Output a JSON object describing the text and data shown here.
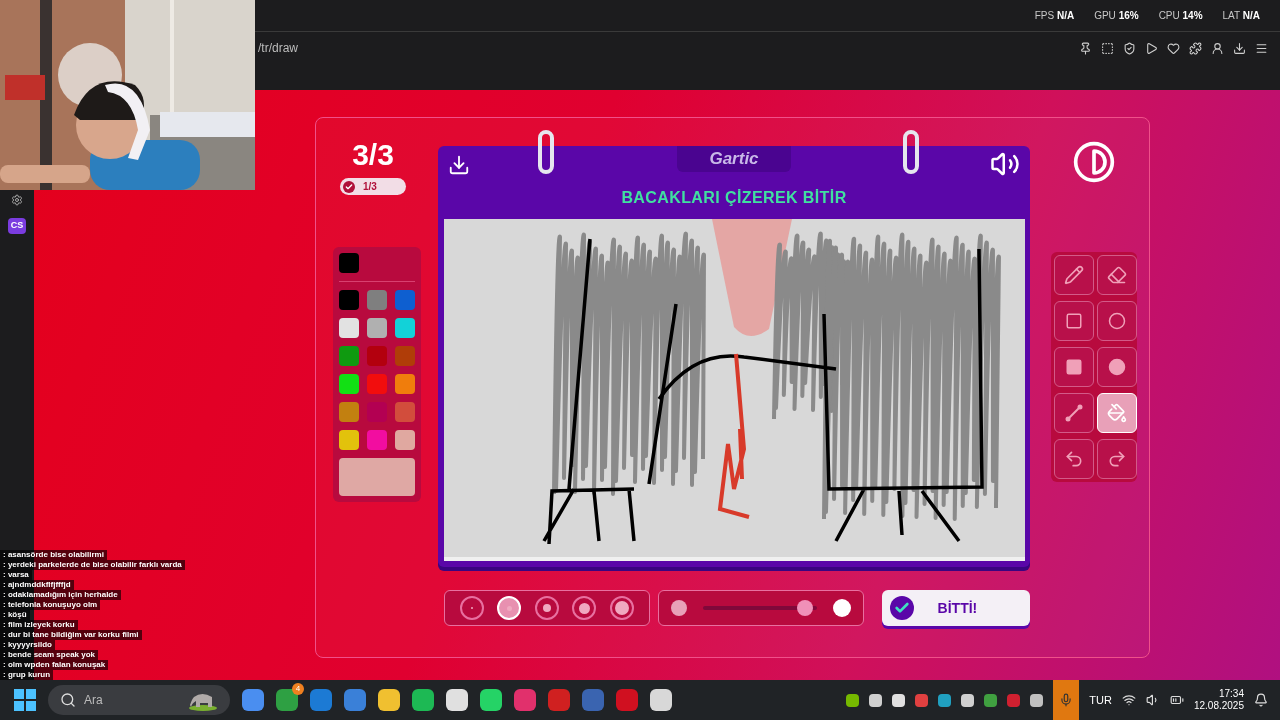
{
  "browser": {
    "url": "/tr/draw",
    "stats": [
      {
        "label": "FPS",
        "value": "N/A"
      },
      {
        "label": "GPU",
        "value": "16%"
      },
      {
        "label": "CPU",
        "value": "14%"
      },
      {
        "label": "LAT",
        "value": "N/A"
      }
    ],
    "sidebar_badge": "CS"
  },
  "chat": [
    {
      "text": ": asansörde bise olabilirmi"
    },
    {
      "text": ": yerdeki parkelerde de bise olabilir farklı varda"
    },
    {
      "text": ": varsa"
    },
    {
      "text": ": ajndmddkflfjfffjd"
    },
    {
      "text": ": odaklamadığım için herhalde"
    },
    {
      "text": ": telefonla konuşuyo olm"
    },
    {
      "text": ": köşü"
    },
    {
      "text": ": film izleyek korku"
    },
    {
      "text": ": dur bi tane bildiğim var korku filmi"
    },
    {
      "text": ": kyyyyrsildo"
    },
    {
      "text": ": bende seam speak yok"
    },
    {
      "text": ": olm wpden falan konuşak"
    },
    {
      "text": ": grup kurun"
    }
  ],
  "game": {
    "round": "3/3",
    "progress": "1/3",
    "logo": "Gartic",
    "prompt": "BACAKLARI ÇİZEREK BİTİR",
    "current_colors": [
      {
        "color": "#000000"
      },
      {
        "color": "#dfa8a4"
      }
    ],
    "palette": [
      {
        "color": "#000000"
      },
      {
        "color": "#7f7f7f"
      },
      {
        "color": "#0e5fd0"
      },
      {
        "color": "#e2e2e2"
      },
      {
        "color": "#b0b0b0"
      },
      {
        "color": "#12d2d8"
      },
      {
        "color": "#0f9a10"
      },
      {
        "color": "#b3000e"
      },
      {
        "color": "#b03d08"
      },
      {
        "color": "#12e014"
      },
      {
        "color": "#f20d0d"
      },
      {
        "color": "#f07d0c"
      },
      {
        "color": "#c28010"
      },
      {
        "color": "#b30052"
      },
      {
        "color": "#d24d3c"
      },
      {
        "color": "#e2c20c"
      },
      {
        "color": "#f20da0"
      },
      {
        "color": "#e0a8a0"
      }
    ],
    "tools": [
      {
        "kind": "pencil",
        "selected": false
      },
      {
        "kind": "eraser",
        "selected": false
      },
      {
        "kind": "rectangle",
        "selected": false
      },
      {
        "kind": "ellipse",
        "selected": false
      },
      {
        "kind": "filled-rectangle",
        "selected": false
      },
      {
        "kind": "filled-ellipse",
        "selected": false
      },
      {
        "kind": "line",
        "selected": false
      },
      {
        "kind": "fill",
        "selected": true
      },
      {
        "kind": "undo",
        "selected": false
      },
      {
        "kind": "redo",
        "selected": false
      }
    ],
    "brush_sizes": [
      {
        "selected": false
      },
      {
        "selected": true
      },
      {
        "selected": false
      },
      {
        "selected": false
      },
      {
        "selected": false
      }
    ],
    "opacity": {
      "level": 0.9
    },
    "done_button": "BİTTİ!"
  },
  "taskbar": {
    "search_placeholder": "Ara",
    "notification_count": "4",
    "language": "TUR",
    "time": "17:34",
    "date": "12.08.2025"
  }
}
